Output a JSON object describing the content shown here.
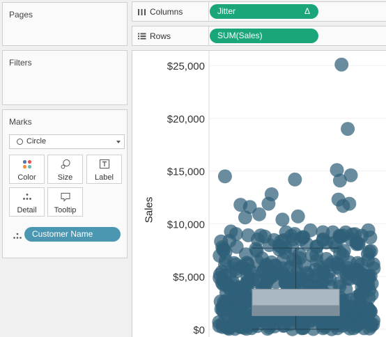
{
  "panels": {
    "pages": {
      "title": "Pages"
    },
    "filters": {
      "title": "Filters"
    },
    "marks": {
      "title": "Marks",
      "mark_type": "Circle",
      "buttons": {
        "color": "Color",
        "size": "Size",
        "label": "Label",
        "detail": "Detail",
        "tooltip": "Tooltip"
      },
      "detail_field": "Customer Name"
    }
  },
  "shelves": {
    "columns": {
      "label": "Columns",
      "pill": "Jitter",
      "pill_icon": "Δ"
    },
    "rows": {
      "label": "Rows",
      "pill": "SUM(Sales)"
    }
  },
  "colors": {
    "columns_pill": "#1aa67a",
    "detail_pill": "#4b97b1",
    "marks": "#2f5f78"
  },
  "chart_data": {
    "type": "scatter",
    "ylabel": "Sales",
    "ylim": [
      -800,
      26400
    ],
    "y_ticks": [
      "$0",
      "$5,000",
      "$10,000",
      "$15,000",
      "$20,000",
      "$25,000"
    ],
    "y_tick_values": [
      0,
      5000,
      10000,
      15000,
      20000,
      25000
    ],
    "xlim": [
      0,
      1
    ],
    "box_plot": {
      "lower_whisker": 0,
      "q1": 1300,
      "median": 2250,
      "q3": 3800,
      "upper_whisker": 7700
    },
    "notable_points": [
      {
        "x": 0.79,
        "y": 25100
      },
      {
        "x": 0.83,
        "y": 19000
      },
      {
        "x": 0.85,
        "y": 14600
      },
      {
        "x": 0.04,
        "y": 14500
      },
      {
        "x": 0.49,
        "y": 14200
      },
      {
        "x": 0.76,
        "y": 15100
      },
      {
        "x": 0.78,
        "y": 14100
      },
      {
        "x": 0.8,
        "y": 11700
      },
      {
        "x": 0.77,
        "y": 12300
      },
      {
        "x": 0.84,
        "y": 11900
      },
      {
        "x": 0.34,
        "y": 12800
      },
      {
        "x": 0.14,
        "y": 11800
      },
      {
        "x": 0.2,
        "y": 11600
      },
      {
        "x": 0.32,
        "y": 11900
      },
      {
        "x": 0.26,
        "y": 10900
      },
      {
        "x": 0.17,
        "y": 10600
      },
      {
        "x": 0.41,
        "y": 10400
      },
      {
        "x": 0.51,
        "y": 10700
      },
      {
        "x": 0.03,
        "y": 7600
      },
      {
        "x": 0.86,
        "y": 9000
      },
      {
        "x": 0.9,
        "y": 8100
      },
      {
        "x": 0.67,
        "y": 9200
      }
    ]
  }
}
